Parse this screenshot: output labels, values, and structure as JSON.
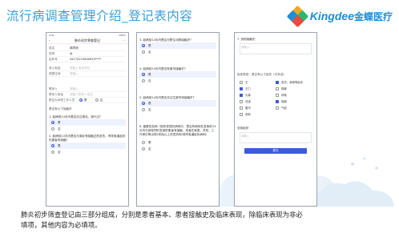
{
  "slide": {
    "title": "流行病调查管理介绍_登记表内容",
    "caption": "肺炎初步筛查登记由三部分组成，分别是患者基本、患者接触史及临床表现，除临床表现为非必填项，其他内容为必填项。",
    "brand_en": "Kingdee",
    "brand_cn": "金蝶医疗",
    "brand_color": "#1a8fd6",
    "title_color": "#3a9fd8"
  },
  "phone1": {
    "status_time": "9:41",
    "status_right": "100%",
    "nav_title": "肺炎初步筛查登记",
    "fields": [
      {
        "label": "姓名",
        "value": "郭同测"
      },
      {
        "label": "性别",
        "value": "女"
      },
      {
        "label": "证件号",
        "value": "44170219840620****"
      }
    ],
    "fields2": [
      {
        "label": "录入电话",
        "placeholder": "请输入电话号码"
      },
      {
        "label": "现居住地",
        "placeholder": "请输入"
      }
    ],
    "fields3": [
      {
        "label": "联系人",
        "placeholder": "请输入"
      },
      {
        "label": "联系人电话",
        "placeholder": "请输入联系人电话"
      }
    ],
    "staff_q": "是否为本院工作人员",
    "staff_yes": "是",
    "staff_no": "否",
    "section": "是否有以下接触史",
    "q1": "1. 起病前14天内是否去过湖北，旅行过？",
    "q1_yes": "是",
    "q1_no": "否",
    "q2": "2. 起病前14天内是否与湖北有接触过的发热、有呼吸道症状的患者有接触？",
    "q2_yes": "是",
    "q2_no": "否"
  },
  "phone2": {
    "q3": "3. 起病前14天内是否与野生动物接触史?",
    "q3_yes": "是",
    "q3_no": "否",
    "q4": "4. 起病前14天内是否有禽鸟接触史?",
    "q4_yes": "是",
    "q4_no": "否",
    "q5": "5. 起病前14天内是否去过生鲜市场接触史?",
    "q5_yes": "是",
    "q5_no": "否",
    "q6": "6. 聚集性发病（指所发现的病例中，是否有病例在发病前14天内与其他同时发病的患者有接触，或者在家庭、学校、工作单位等出现2例及以上的发热和/或呼吸道症状病例）",
    "q6_yes": "是",
    "q6_no": "否"
  },
  "phone3": {
    "top_label": "7. 其他接触史",
    "top_placeholder": "请输入",
    "section": "临床表现：是否有以下症状（可多选）",
    "symptoms": [
      {
        "label": "无",
        "checked": false
      },
      {
        "label": "发热、咳嗽等症状",
        "checked": true
      },
      {
        "label": "乏力",
        "checked": true
      },
      {
        "label": "咽痛",
        "checked": false
      },
      {
        "label": "头痛",
        "checked": true
      },
      {
        "label": "咳嗽",
        "checked": false
      },
      {
        "label": "流涕",
        "checked": false
      },
      {
        "label": "咽痛",
        "checked": true
      },
      {
        "label": "腹泻",
        "checked": false
      },
      {
        "label": "气促",
        "checked": false
      },
      {
        "label": "其他",
        "checked": false
      }
    ],
    "other_label": "全身症状",
    "other_placeholder": "请输入",
    "submit": "提交"
  }
}
